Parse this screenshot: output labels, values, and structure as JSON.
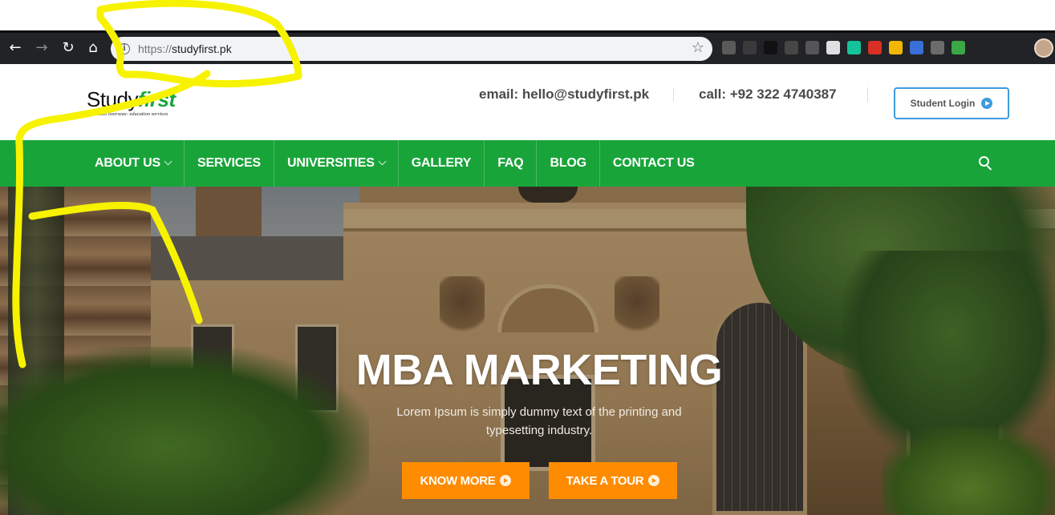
{
  "browser": {
    "url_scheme": "https://",
    "url_host": "studyfirst.pk",
    "nav_icons": [
      "back-arrow-icon",
      "forward-arrow-icon",
      "reload-icon",
      "home-icon"
    ],
    "extensions": [
      {
        "name": "camera-extension-icon",
        "color": "#5a5a5a"
      },
      {
        "name": "pen-extension-icon",
        "color": "#3a3a3a"
      },
      {
        "name": "qr-extension-icon",
        "color": "#111111"
      },
      {
        "name": "wordpress-extension-icon",
        "color": "#464646"
      },
      {
        "name": "eye-extension-icon",
        "color": "#555555"
      },
      {
        "name": "white-square-extension-icon",
        "color": "#e0e0e0"
      },
      {
        "name": "grammarly-extension-icon",
        "color": "#15c39a"
      },
      {
        "name": "gmail-extension-icon",
        "color": "#d93025"
      },
      {
        "name": "notes-extension-icon",
        "color": "#f2b705"
      },
      {
        "name": "screenshot-extension-icon",
        "color": "#3b6fd8"
      },
      {
        "name": "head-extension-icon",
        "color": "#6b6b6b"
      },
      {
        "name": "color-picker-extension-icon",
        "color": "#39a845"
      }
    ]
  },
  "header": {
    "logo_study": "Study",
    "logo_first": "first",
    "logo_tagline": "1st class overseas- education services",
    "email": "email: hello@studyfirst.pk",
    "phone": "call: +92 322 4740387",
    "login_label": "Student Login"
  },
  "nav": {
    "items": [
      {
        "label": "ABOUT US",
        "has_dropdown": true
      },
      {
        "label": "SERVICES",
        "has_dropdown": false
      },
      {
        "label": "UNIVERSITIES",
        "has_dropdown": true
      },
      {
        "label": "GALLERY",
        "has_dropdown": false
      },
      {
        "label": "FAQ",
        "has_dropdown": false
      },
      {
        "label": "BLOG",
        "has_dropdown": false
      },
      {
        "label": "CONTACT US",
        "has_dropdown": false
      }
    ]
  },
  "hero": {
    "title": "MBA MARKETING",
    "subtitle": "Lorem Ipsum is simply dummy text of the printing and typesetting industry.",
    "primary_button": "KNOW MORE",
    "secondary_button": "TAKE A TOUR"
  },
  "colors": {
    "brand_green": "#19a43a",
    "accent_orange": "#ff8c00",
    "login_blue": "#3e9bdc",
    "annotation_yellow": "#f7f200"
  }
}
